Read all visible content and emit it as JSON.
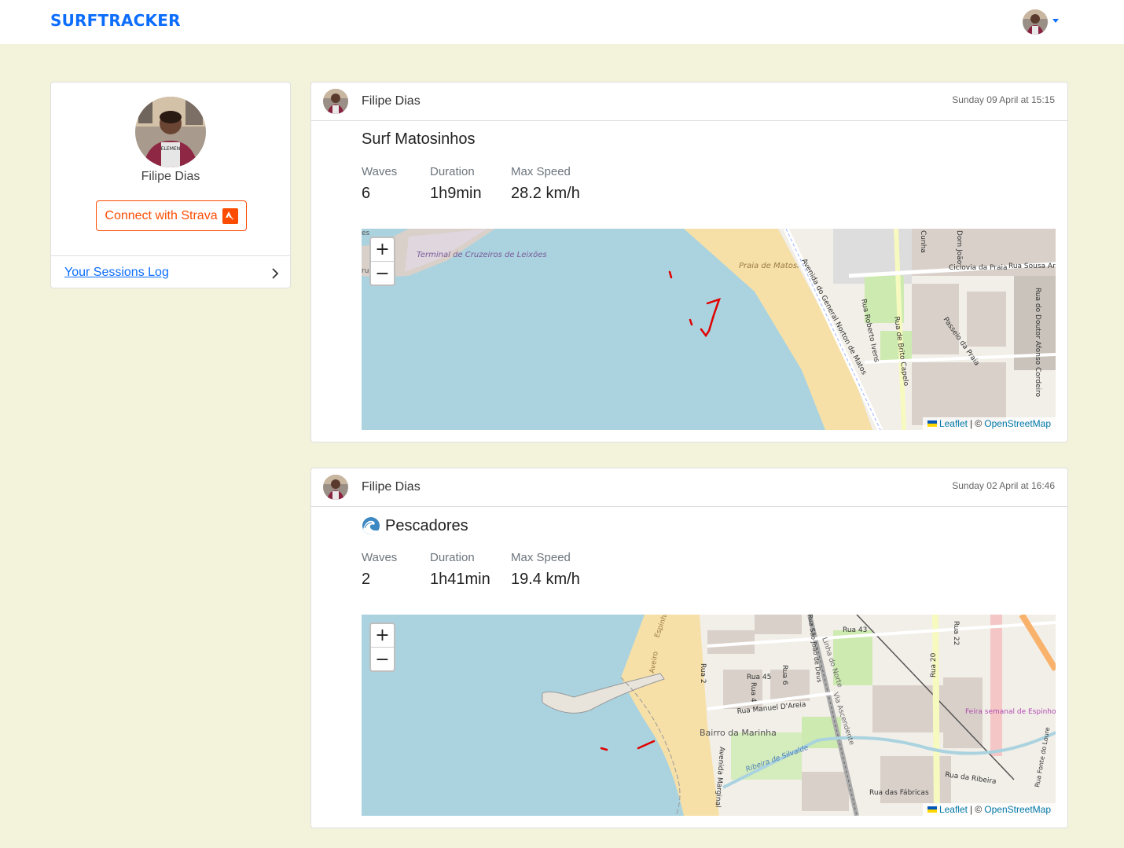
{
  "navbar": {
    "brand": "SURFTRACKER"
  },
  "profile": {
    "name": "Filipe Dias",
    "strava_button": "Connect with Strava",
    "sessions_link": "Your Sessions Log"
  },
  "sessions": [
    {
      "user": "Filipe Dias",
      "date": "Sunday 09 April at 15:15",
      "title": "Surf Matosinhos",
      "stats": [
        {
          "label": "Waves",
          "value": "6"
        },
        {
          "label": "Duration",
          "value": "1h9min"
        },
        {
          "label": "Max Speed",
          "value": "28.2 km/h"
        }
      ],
      "map": {
        "labels": [
          "Terminal de Cruzeiros de Leixões",
          "Praia de Matosinhos",
          "Avenida do General Norton de Matos",
          "Rua Roberto Ivens",
          "Rua de Brito Capelo",
          "Passeio da Praia",
          "Ciclovia da Praia",
          "Rua Sousa Aro",
          "Rua do Doutor Afonso Cordeiro",
          "Dom João",
          "Cunha",
          "es",
          "rua"
        ]
      }
    },
    {
      "user": "Filipe Dias",
      "date": "Sunday 02 April at 16:46",
      "title": "Pescadores",
      "title_icon": "wave-emoji",
      "stats": [
        {
          "label": "Waves",
          "value": "2"
        },
        {
          "label": "Duration",
          "value": "1h41min"
        },
        {
          "label": "Max Speed",
          "value": "19.4 km/h"
        }
      ],
      "map": {
        "labels": [
          "Espinho",
          "Aveiro",
          "Rua 43",
          "Rua 45",
          "Rua 2",
          "Rua 4",
          "Rua 6",
          "Rua 20",
          "Rua 22",
          "Rua Manuel D'Areia",
          "Bairro da Marinha",
          "Ribeira de Silvalde",
          "Avenida Marginal",
          "Rua da Ribeira",
          "Rua das Fábricas",
          "Feira semanal de Espinho",
          "Rua Fonte do Loure",
          "Linha do Norte",
          "Via Ascendente",
          "Rua São João de Deus"
        ]
      }
    }
  ],
  "map_controls": {
    "zoom_in": "+",
    "zoom_out": "−",
    "leaflet": "Leaflet",
    "separator": "| ©",
    "osm": "OpenStreetMap"
  },
  "colors": {
    "brand": "#0d6efd",
    "strava": "#fc4c02",
    "background": "#f3f3dc",
    "water": "#aad3df",
    "beach": "#f7e0a8",
    "track": "#e00000"
  }
}
